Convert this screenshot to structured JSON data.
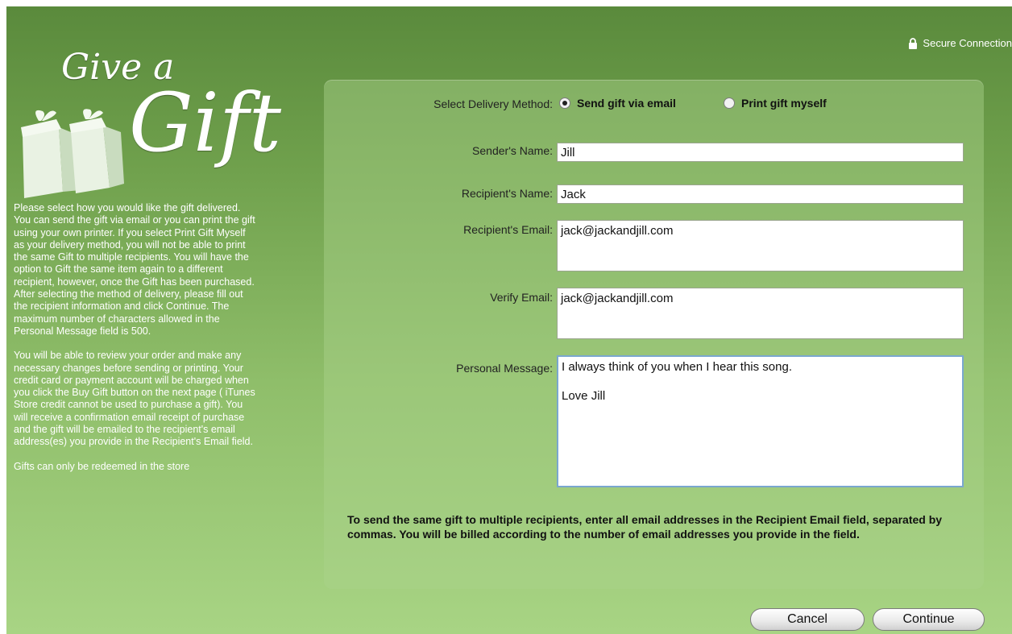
{
  "header": {
    "secure_label": "Secure Connection",
    "lock_icon": "lock-icon"
  },
  "logo": {
    "line1": "Give a",
    "line2": "Gift"
  },
  "info": {
    "paragraph1": "Please select how you would like the gift delivered. You can send the gift via email or you can print the gift using your own printer. If you select Print Gift Myself as your delivery method, you will not be able to print the same Gift to multiple recipients. You will have the option to Gift the same item again to a different recipient, however, once the Gift has been purchased. After selecting the method of delivery, please fill out the recipient information and click Continue. The maximum number of characters allowed in the Personal Message field is 500.",
    "paragraph2": "You will be able to review your order and make any necessary changes before sending or printing. Your credit card or payment account will be charged when you click the Buy Gift button on the next page ( iTunes Store credit cannot be used to purchase a gift). You will receive a confirmation email receipt of purchase and the gift will be emailed to the recipient's email address(es) you provide in the Recipient's Email field.",
    "paragraph3": "Gifts can only be redeemed in the store"
  },
  "form": {
    "delivery_label": "Select Delivery Method:",
    "delivery_options": [
      {
        "label": "Send gift via email",
        "selected": true
      },
      {
        "label": "Print gift myself",
        "selected": false
      }
    ],
    "sender_label": "Sender's Name:",
    "sender_value": "Jill",
    "recipient_name_label": "Recipient's Name:",
    "recipient_name_value": "Jack",
    "recipient_email_label": "Recipient's Email:",
    "recipient_email_value": "jack@jackandjill.com",
    "verify_email_label": "Verify Email:",
    "verify_email_value": "jack@jackandjill.com",
    "message_label": "Personal Message:",
    "message_value": "I always think of you when I hear this song.\n\nLove Jill",
    "note": "To send the same gift to multiple recipients, enter all email addresses in the Recipient Email field, separated by commas. You will be billed according to the number of email addresses you provide in the field."
  },
  "buttons": {
    "cancel": "Cancel",
    "continue": "Continue"
  },
  "colors": {
    "background_top": "#5a8a3c",
    "background_bottom": "#a8d484",
    "focus_border": "#7aa7cf"
  }
}
